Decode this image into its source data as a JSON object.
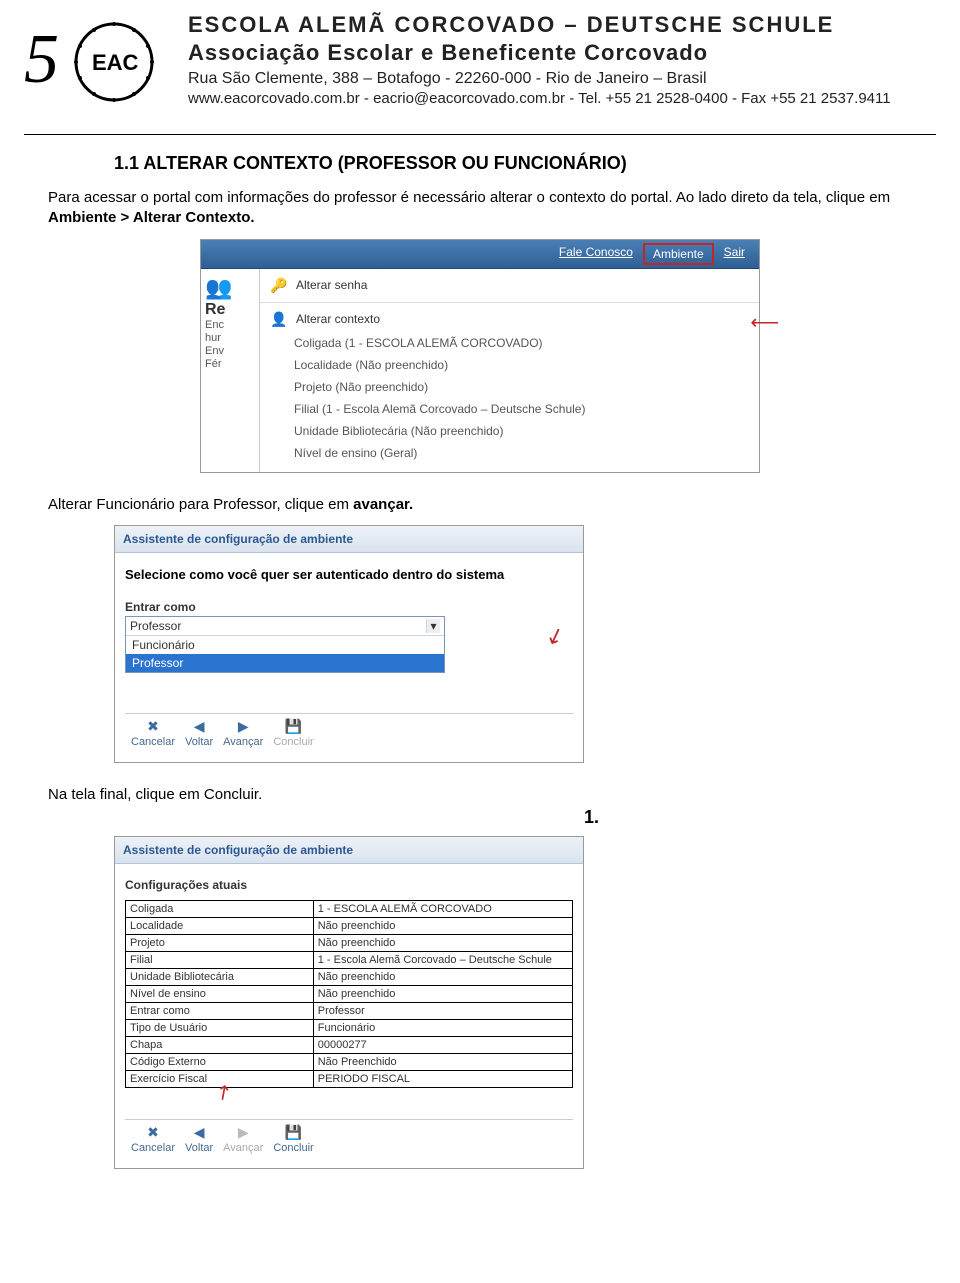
{
  "header": {
    "title1": "ESCOLA ALEMÃ CORCOVADO – DEUTSCHE SCHULE",
    "title2": "Associação Escolar e Beneficente Corcovado",
    "address": "Rua São Clemente, 388 – Botafogo - 22260-000 - Rio de Janeiro – Brasil",
    "contact": "www.eacorcovado.com.br - eacrio@eacorcovado.com.br - Tel. +55 21 2528-0400 - Fax +55 21 2537.9411"
  },
  "section_title": "1.1 ALTERAR CONTEXTO (PROFESSOR OU FUNCIONÁRIO)",
  "para1_pre": "Para acessar o portal com informações do professor é necessário alterar o contexto do portal. Ao lado direto da tela, clique em ",
  "para1_bold": "Ambiente > Alterar Contexto.",
  "ss1": {
    "topbar": {
      "fale": "Fale Conosco",
      "ambiente": "Ambiente",
      "sair": "Sair"
    },
    "left": {
      "r_title": "Re",
      "r_sub1": "Enc",
      "r_sub2": "hur",
      "r_sub3": "Env",
      "r_sub4": "Fér"
    },
    "menu": {
      "alterar_senha": "Alterar senha",
      "alterar_contexto": "Alterar contexto",
      "coligada": "Coligada (1 - ESCOLA ALEMÃ CORCOVADO)",
      "localidade": "Localidade (Não preenchido)",
      "projeto": "Projeto (Não preenchido)",
      "filial": "Filial (1 - Escola Alemã Corcovado – Deutsche Schule)",
      "unidade": "Unidade Bibliotecária (Não preenchido)",
      "nivel": "Nível de ensino (Geral)"
    }
  },
  "para2_pre": "Alterar Funcionário para Professor, clique em ",
  "para2_bold": "avançar.",
  "ss2": {
    "title": "Assistente de configuração de ambiente",
    "subtitle": "Selecione como você quer ser autenticado dentro do sistema",
    "label": "Entrar como",
    "selected": "Professor",
    "opt1": "Funcionário",
    "opt2": "Professor",
    "wiz": {
      "cancelar": "Cancelar",
      "voltar": "Voltar",
      "avancar": "Avançar",
      "concluir": "Concluir"
    }
  },
  "para3_pre": "Na tela final, clique em Concluir.",
  "number_one": "1.",
  "ss3": {
    "title": "Assistente de configuração de ambiente",
    "subtitle": "Configurações atuais",
    "rows": [
      {
        "k": "Coligada",
        "v": "1 - ESCOLA ALEMÃ CORCOVADO"
      },
      {
        "k": "Localidade",
        "v": "Não preenchido"
      },
      {
        "k": "Projeto",
        "v": "Não preenchido"
      },
      {
        "k": "Filial",
        "v": "1 - Escola Alemã Corcovado – Deutsche Schule"
      },
      {
        "k": "Unidade Bibliotecária",
        "v": "Não preenchido"
      },
      {
        "k": "Nível de ensino",
        "v": "Não preenchido"
      },
      {
        "k": "Entrar como",
        "v": "Professor"
      },
      {
        "k": "Tipo de Usuário",
        "v": "Funcionário"
      },
      {
        "k": "Chapa",
        "v": "00000277"
      },
      {
        "k": "Código Externo",
        "v": "Não Preenchido"
      },
      {
        "k": "Exercício Fiscal",
        "v": "PERIODO FISCAL"
      }
    ],
    "wiz": {
      "cancelar": "Cancelar",
      "voltar": "Voltar",
      "avancar": "Avançar",
      "concluir": "Concluir"
    }
  }
}
